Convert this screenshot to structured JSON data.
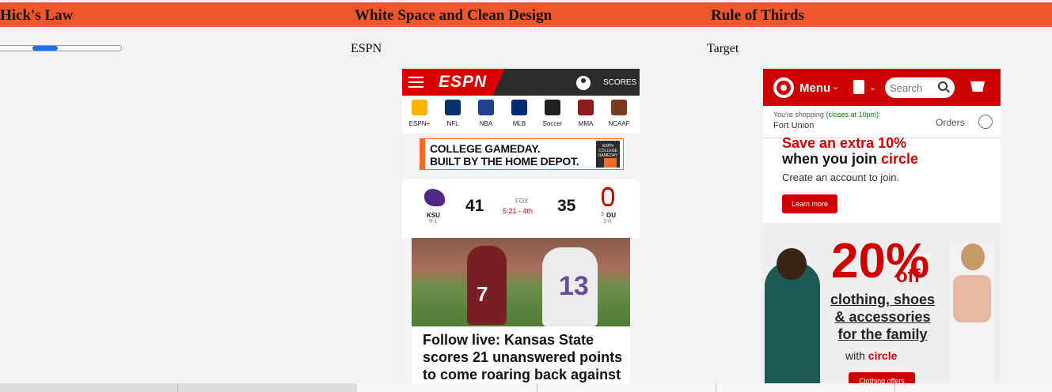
{
  "headers": [
    "Hick's Law",
    "White Space and Clean Design",
    "Rule of Thirds"
  ],
  "slider": {
    "value": 0.4
  },
  "columns": {
    "espn_label": "ESPN",
    "target_label": "Target"
  },
  "espn": {
    "logo": "ESPN",
    "scores": "SCORES",
    "nav": [
      {
        "label": "ESPN+",
        "icon": "plus-icon",
        "color": "#f4b400"
      },
      {
        "label": "NFL",
        "icon": "nfl-icon",
        "color": "#013369"
      },
      {
        "label": "NBA",
        "icon": "nba-icon",
        "color": "#1d428a"
      },
      {
        "label": "MLB",
        "icon": "mlb-icon",
        "color": "#002d72"
      },
      {
        "label": "Soccer",
        "icon": "soccer-icon",
        "color": "#222222"
      },
      {
        "label": "MMA",
        "icon": "mma-icon",
        "color": "#8b1a1a"
      },
      {
        "label": "NCAAF",
        "icon": "football-icon",
        "color": "#7a3b1f"
      }
    ],
    "ad": {
      "line1": "COLLEGE GAMEDAY.",
      "line2": "BUILT BY THE HOME DEPOT.",
      "badge": "ESPN COLLEGE GAMEDAY"
    },
    "game": {
      "away": {
        "abbr": "KSU",
        "record": "0-1",
        "score": "41"
      },
      "home": {
        "abbr": "OU",
        "rank": "3",
        "record": "1-0",
        "score": "35"
      },
      "network": "FOX",
      "clock": "5:21 - 4th"
    },
    "photo_numbers": {
      "left": "7",
      "right": "13"
    },
    "headline": "Follow live: Kansas State scores 21 unanswered points to come roaring back against"
  },
  "target": {
    "menu": "Menu",
    "search_placeholder": "Search",
    "shopping": "You're shopping",
    "closes": "(closes at 10pm):",
    "store": "Fort Union",
    "orders": "Orders",
    "promo_line1": "Save an extra 10%",
    "promo_line2a": "when you join ",
    "promo_line2b": "circle",
    "promo_sub": "Create an account to join.",
    "learn_more": "Learn more",
    "big_pct": "20%",
    "off": "off",
    "categories": "clothing, shoes & accessories for the family",
    "with": "with ",
    "circle": "circle",
    "cta": "Clothing offers"
  },
  "colors": {
    "accent": "#f0562b",
    "espn_red": "#dd0000",
    "target_red": "#cc0000",
    "slider": "#1a73e8"
  }
}
